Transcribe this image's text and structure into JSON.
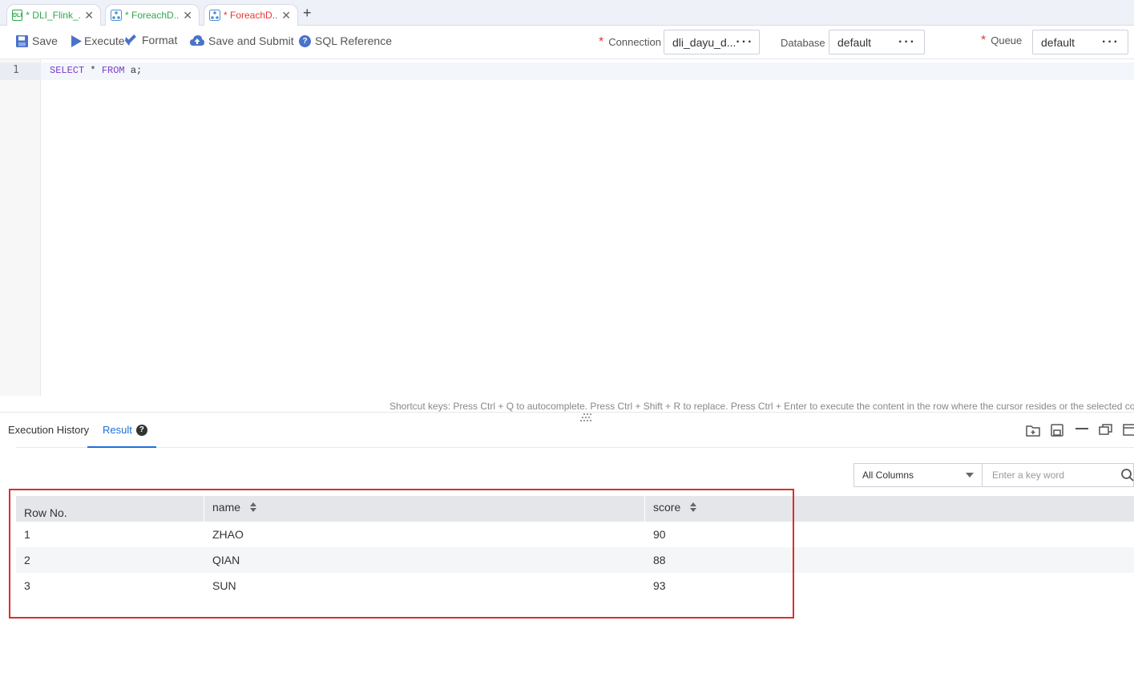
{
  "tabs": [
    {
      "label": "* DLI_Flink_...",
      "color": "#2fa84f",
      "icon": "dli-icon"
    },
    {
      "label": "* ForeachD...",
      "color": "#2fa84f",
      "icon": "workflow-icon"
    },
    {
      "label": "* ForeachD...",
      "color": "#e53935",
      "icon": "workflow-icon"
    }
  ],
  "toolbar": {
    "save": "Save",
    "execute": "Execute",
    "format": "Format",
    "save_submit": "Save and Submit",
    "sql_reference": "SQL Reference",
    "connection_label": "Connection",
    "connection_value": "dli_dayu_d...",
    "database_label": "Database",
    "database_value": "default",
    "queue_label": "Queue",
    "queue_value": "default"
  },
  "editor": {
    "line_number": "1",
    "kw_select": "SELECT",
    "star": " * ",
    "kw_from": "FROM",
    "rest": " a;"
  },
  "hint": "Shortcut keys: Press Ctrl + Q to autocomplete. Press Ctrl + Shift + R to replace. Press Ctrl + Enter to execute the content in the row where the cursor resides or the selected content.",
  "result_tabs": {
    "history": "Execution History",
    "result": "Result"
  },
  "filter": {
    "column_select": "All Columns",
    "search_placeholder": "Enter a key word"
  },
  "table": {
    "headers": {
      "row_no": "Row No.",
      "name": "name",
      "score": "score"
    },
    "rows": [
      {
        "row_no": "1",
        "name": "ZHAO",
        "score": "90"
      },
      {
        "row_no": "2",
        "name": "QIAN",
        "score": "88"
      },
      {
        "row_no": "3",
        "name": "SUN",
        "score": "93"
      }
    ]
  },
  "colors": {
    "accent": "#1e6fd9",
    "highlight": "#d9302c",
    "required": "#e53935"
  }
}
